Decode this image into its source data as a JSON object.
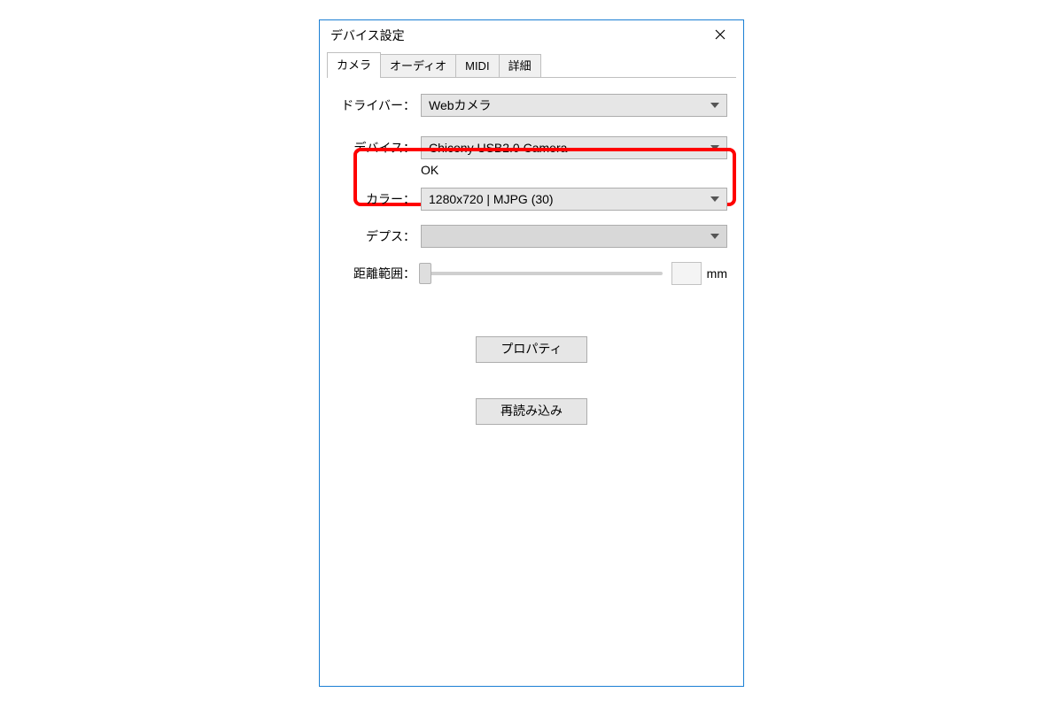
{
  "window": {
    "title": "デバイス設定"
  },
  "tabs": {
    "camera": "カメラ",
    "audio": "オーディオ",
    "midi": "MIDI",
    "advanced": "詳細"
  },
  "labels": {
    "driver": "ドライバー：",
    "device": "デバイス：",
    "color": "カラー：",
    "depth": "デプス：",
    "range": "距離範囲：",
    "mm": "mm"
  },
  "values": {
    "driver": "Webカメラ",
    "device": "Chicony USB2.0 Camera",
    "device_status": "OK",
    "color": "1280x720 | MJPG (30)",
    "depth": "",
    "range_value": ""
  },
  "buttons": {
    "properties": "プロパティ",
    "reload": "再読み込み"
  }
}
